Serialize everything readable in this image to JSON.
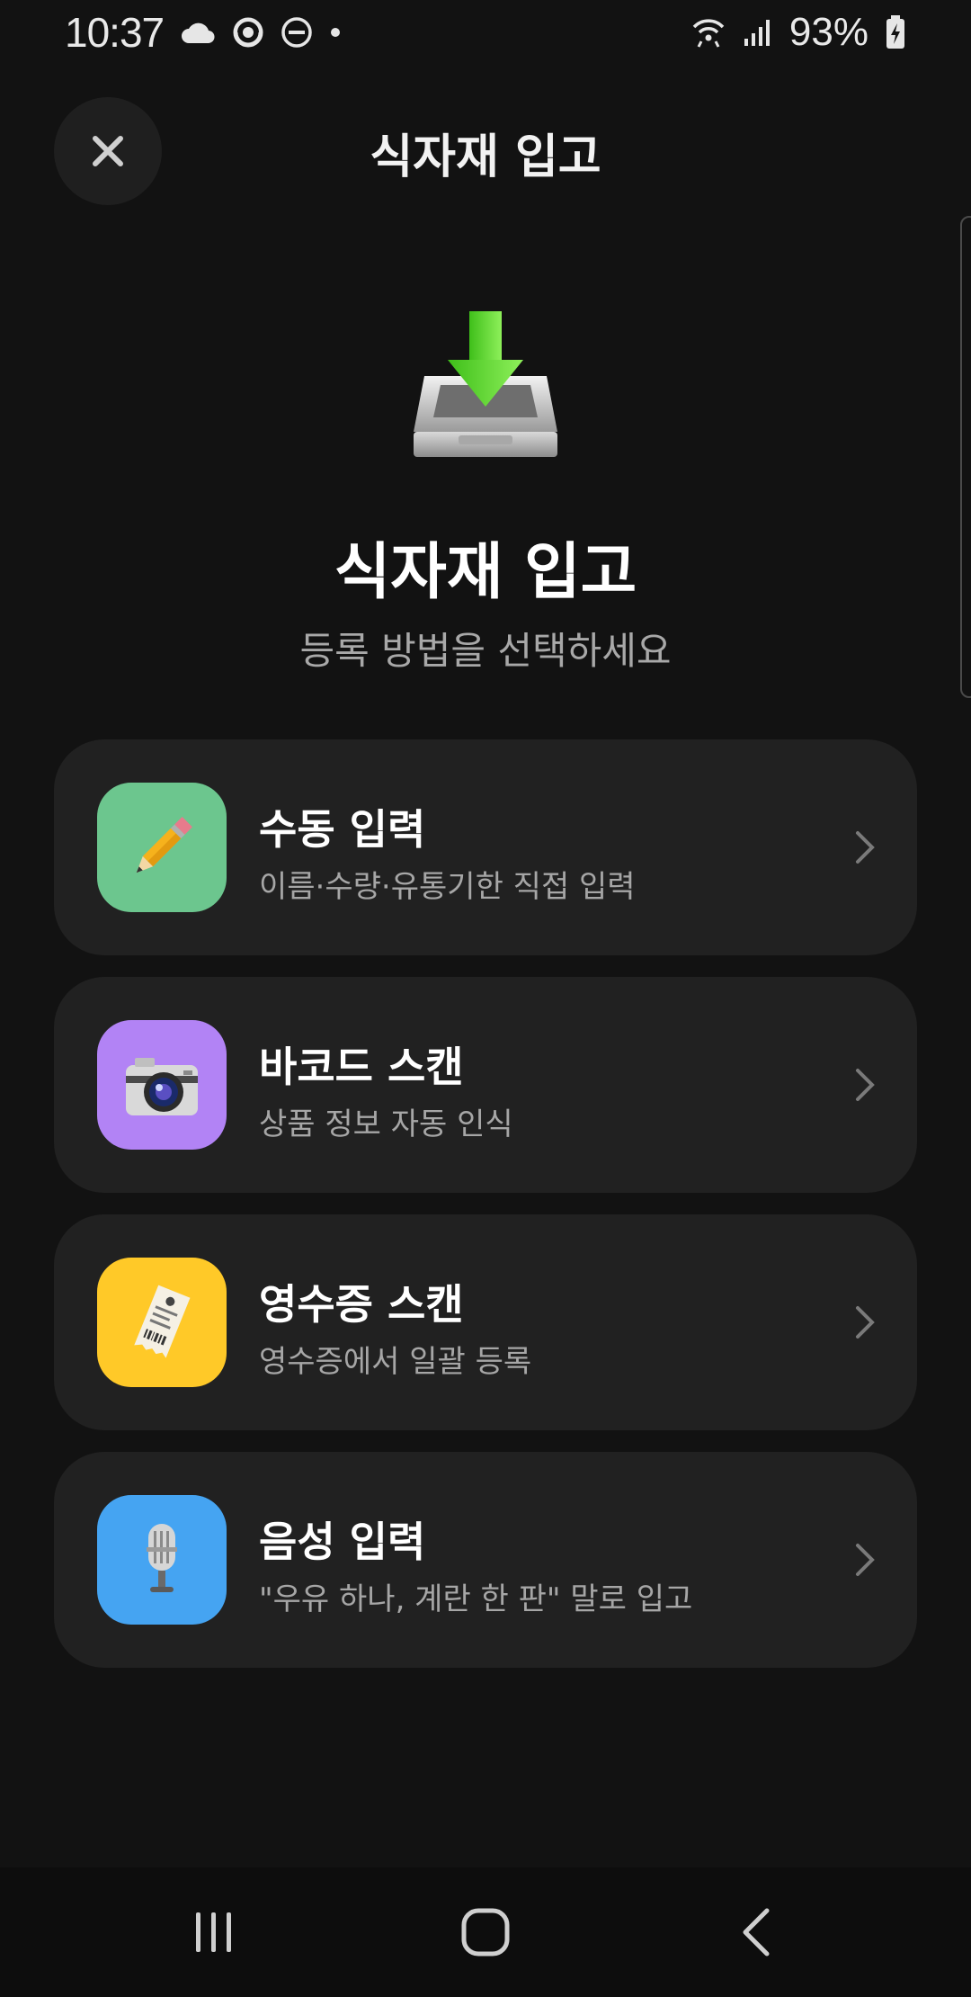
{
  "status_bar": {
    "time": "10:37",
    "left_icons": [
      "cloud-icon",
      "sync-icon",
      "do-not-disturb-icon",
      "dot-icon"
    ],
    "right_icons": [
      "wifi-icon",
      "cellular-signal-icon",
      "battery-charging-icon"
    ],
    "battery_percent": "93%"
  },
  "header": {
    "title": "식자재 입고",
    "close_icon": "close-icon"
  },
  "hero": {
    "icon": "inbox-download-icon",
    "title": "식자재 입고",
    "subtitle": "등록 방법을 선택하세요"
  },
  "options": [
    {
      "title": "수동 입력",
      "description": "이름·수량·유통기한 직접 입력",
      "icon": "pencil-icon",
      "tile_color": "#6cc68e"
    },
    {
      "title": "바코드 스캔",
      "description": "상품 정보 자동 인식",
      "icon": "camera-icon",
      "tile_color": "#b283f5"
    },
    {
      "title": "영수증 스캔",
      "description": "영수증에서 일괄 등록",
      "icon": "receipt-icon",
      "tile_color": "#ffc928"
    },
    {
      "title": "음성 입력",
      "description": "\"우유 하나, 계란 한 판\" 말로 입고",
      "icon": "microphone-icon",
      "tile_color": "#45a4f2"
    }
  ],
  "colors": {
    "background": "#121212",
    "card": "#212121",
    "secondary_text": "#a6a6a6"
  },
  "nav_bar": {
    "buttons": [
      "recent-apps-icon",
      "home-icon",
      "back-icon"
    ]
  }
}
